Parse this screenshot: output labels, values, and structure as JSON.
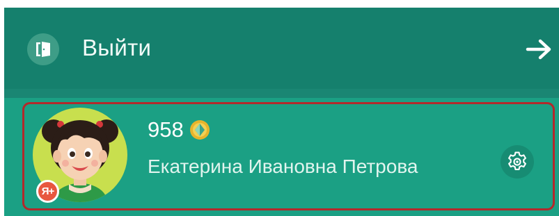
{
  "logout": {
    "label": "Выйти",
    "icon": "exit-door-icon",
    "arrow_icon": "arrow-right-icon"
  },
  "profile": {
    "points": "958",
    "points_icon": "gem-icon",
    "full_name": "Екатерина Ивановна Петрова",
    "avatar": "girl-avatar",
    "badge_label": "Я+",
    "settings_icon": "gear-icon"
  },
  "colors": {
    "header_bg": "#15806d",
    "card_bg": "#1ba084",
    "highlight_border": "#b2292b",
    "avatar_bg": "#c8df4e",
    "badge_bg": "#e8573f"
  }
}
